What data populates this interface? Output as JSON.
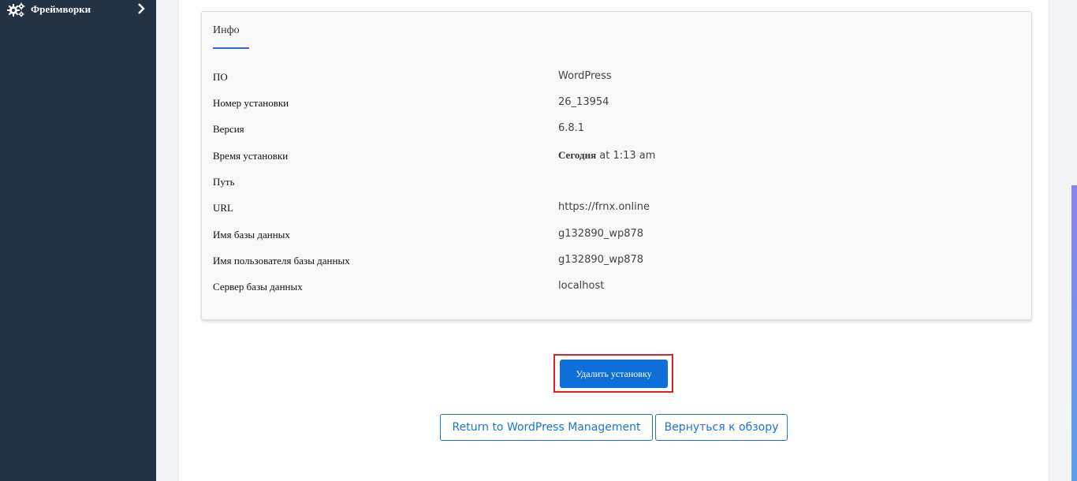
{
  "sidebar": {
    "items": [
      {
        "label": "Фреймворки",
        "icon": "gears-icon"
      }
    ]
  },
  "panel": {
    "tab": "Инфо",
    "rows": [
      {
        "key": "ПО",
        "value": "WordPress"
      },
      {
        "key": "Номер установки",
        "value": "26_13954"
      },
      {
        "key": "Версия",
        "value": "6.8.1"
      },
      {
        "key": "Время установки",
        "value_bold": "Сегодня",
        "value": " at 1:13 am"
      },
      {
        "key": "Путь",
        "value": ""
      },
      {
        "key": "URL",
        "value": "https://frnx.online"
      },
      {
        "key": "Имя базы данных",
        "value": "g132890_wp878"
      },
      {
        "key": "Имя пользователя базы данных",
        "value": "g132890_wp878"
      },
      {
        "key": "Сервер базы данных",
        "value": "localhost"
      }
    ]
  },
  "actions": {
    "delete_label": "Удалить установку",
    "return_label": "Return to WordPress Management",
    "back_label": "Вернуться к обзору"
  },
  "colors": {
    "sidebar_bg": "#233343",
    "primary": "#0e6fd8",
    "highlight": "#d9232a"
  }
}
